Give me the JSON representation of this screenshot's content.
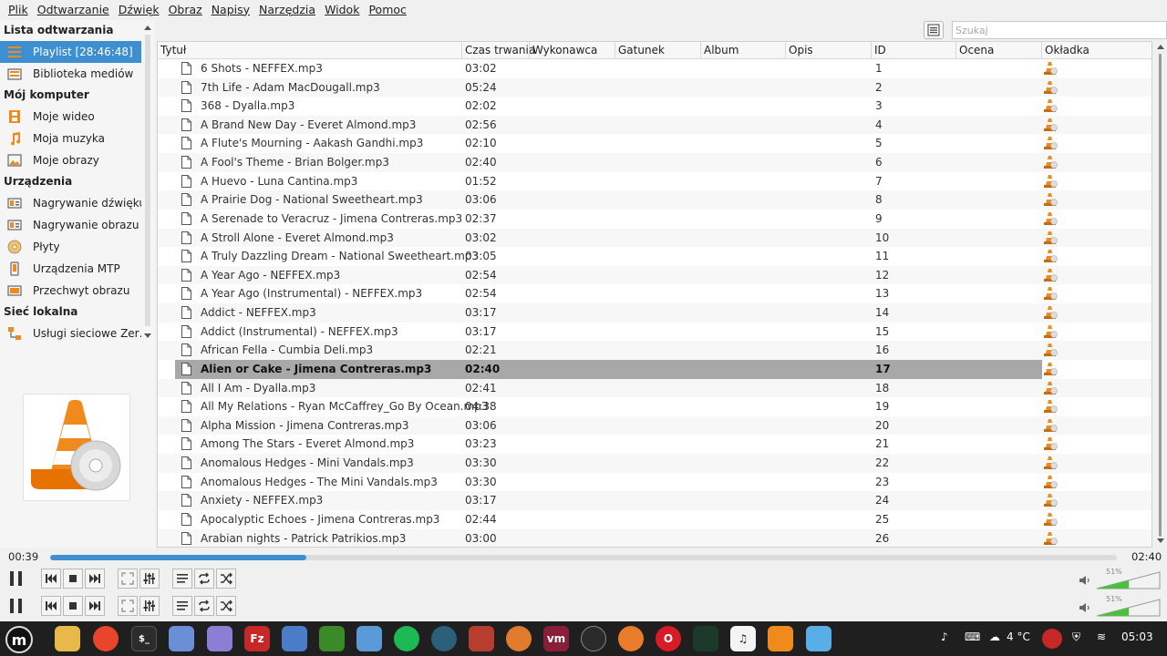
{
  "menu": [
    "Plik",
    "Odtwarzanie",
    "Dźwięk",
    "Obraz",
    "Napisy",
    "Narzędzia",
    "Widok",
    "Pomoc"
  ],
  "sidebar": {
    "sections": [
      {
        "heading": "Lista odtwarzania",
        "items": [
          {
            "label": "Playlist [28:46:48]",
            "icon": "playlist-icon",
            "selected": true
          },
          {
            "label": "Biblioteka mediów",
            "icon": "media-library-icon"
          }
        ]
      },
      {
        "heading": "Mój komputer",
        "items": [
          {
            "label": "Moje wideo",
            "icon": "video-icon"
          },
          {
            "label": "Moja muzyka",
            "icon": "music-icon"
          },
          {
            "label": "Moje obrazy",
            "icon": "pictures-icon"
          }
        ]
      },
      {
        "heading": "Urządzenia",
        "items": [
          {
            "label": "Nagrywanie dźwięku",
            "icon": "audio-capture-icon"
          },
          {
            "label": "Nagrywanie obrazu",
            "icon": "video-capture-icon"
          },
          {
            "label": "Płyty",
            "icon": "disc-icon"
          },
          {
            "label": "Urządzenia MTP",
            "icon": "mtp-device-icon"
          },
          {
            "label": "Przechwyt obrazu",
            "icon": "screen-capture-icon"
          }
        ]
      },
      {
        "heading": "Sieć lokalna",
        "items": [
          {
            "label": "Usługi sieciowe Zer…",
            "icon": "network-icon"
          }
        ]
      }
    ]
  },
  "search": {
    "placeholder": "Szukaj"
  },
  "columns": [
    "Tytuł",
    "Czas trwania",
    "Wykonawca",
    "Gatunek",
    "Album",
    "Opis",
    "ID",
    "Ocena",
    "Okładka"
  ],
  "tracks": [
    {
      "title": "6 Shots - NEFFEX.mp3",
      "duration": "03:02",
      "id": "1"
    },
    {
      "title": "7th Life - Adam MacDougall.mp3",
      "duration": "05:24",
      "id": "2"
    },
    {
      "title": "368 - Dyalla.mp3",
      "duration": "02:02",
      "id": "3"
    },
    {
      "title": "A Brand New Day - Everet Almond.mp3",
      "duration": "02:56",
      "id": "4"
    },
    {
      "title": "A Flute's Mourning - Aakash Gandhi.mp3",
      "duration": "02:10",
      "id": "5"
    },
    {
      "title": "A Fool's Theme - Brian Bolger.mp3",
      "duration": "02:40",
      "id": "6"
    },
    {
      "title": "A Huevo - Luna Cantina.mp3",
      "duration": "01:52",
      "id": "7"
    },
    {
      "title": "A Prairie Dog - National Sweetheart.mp3",
      "duration": "03:06",
      "id": "8"
    },
    {
      "title": "A Serenade to Veracruz - Jimena Contreras.mp3",
      "duration": "02:37",
      "id": "9"
    },
    {
      "title": "A Stroll Alone - Everet Almond.mp3",
      "duration": "03:02",
      "id": "10"
    },
    {
      "title": "A Truly Dazzling Dream - National Sweetheart.mp3",
      "duration": "03:05",
      "id": "11"
    },
    {
      "title": "A Year Ago - NEFFEX.mp3",
      "duration": "02:54",
      "id": "12"
    },
    {
      "title": "A Year Ago (Instrumental) - NEFFEX.mp3",
      "duration": "02:54",
      "id": "13"
    },
    {
      "title": "Addict - NEFFEX.mp3",
      "duration": "03:17",
      "id": "14"
    },
    {
      "title": "Addict (Instrumental) - NEFFEX.mp3",
      "duration": "03:17",
      "id": "15"
    },
    {
      "title": "African Fella - Cumbia Deli.mp3",
      "duration": "02:21",
      "id": "16"
    },
    {
      "title": "Alien or Cake - Jimena Contreras.mp3",
      "duration": "02:40",
      "id": "17",
      "selected": true
    },
    {
      "title": "All I Am - Dyalla.mp3",
      "duration": "02:41",
      "id": "18"
    },
    {
      "title": "All My Relations - Ryan McCaffrey_Go By Ocean.mp3",
      "duration": "04:38",
      "id": "19"
    },
    {
      "title": "Alpha Mission - Jimena Contreras.mp3",
      "duration": "03:06",
      "id": "20"
    },
    {
      "title": "Among The Stars - Everet Almond.mp3",
      "duration": "03:23",
      "id": "21"
    },
    {
      "title": "Anomalous Hedges - Mini Vandals.mp3",
      "duration": "03:30",
      "id": "22"
    },
    {
      "title": "Anomalous Hedges - The Mini Vandals.mp3",
      "duration": "03:30",
      "id": "23"
    },
    {
      "title": "Anxiety - NEFFEX.mp3",
      "duration": "03:17",
      "id": "24"
    },
    {
      "title": "Apocalyptic Echoes - Jimena Contreras.mp3",
      "duration": "02:44",
      "id": "25"
    },
    {
      "title": "Arabian nights - Patrick Patrikios.mp3",
      "duration": "03:00",
      "id": "26"
    }
  ],
  "player": {
    "elapsed": "00:39",
    "total": "02:40",
    "progress_fraction": 0.24,
    "volume": "51%",
    "volume_fraction": 0.51
  },
  "taskbar": {
    "apps": [
      "files",
      "firefox",
      "terminal",
      "mail",
      "text-editor",
      "filezilla",
      "screenshot",
      "gecko",
      "browser",
      "spotify",
      "vpn",
      "brick-game",
      "basketball",
      "vm",
      "steam",
      "blender",
      "opera",
      "system-monitor",
      "itunes",
      "vlc",
      "finder"
    ],
    "weather": "4 °C",
    "clock": "05:03"
  },
  "colors": {
    "accent": "#3d8fd1",
    "selected_row": "#a8a8a8",
    "vlc_orange": "#f08a1c",
    "taskbar": "#1f1f1f"
  }
}
